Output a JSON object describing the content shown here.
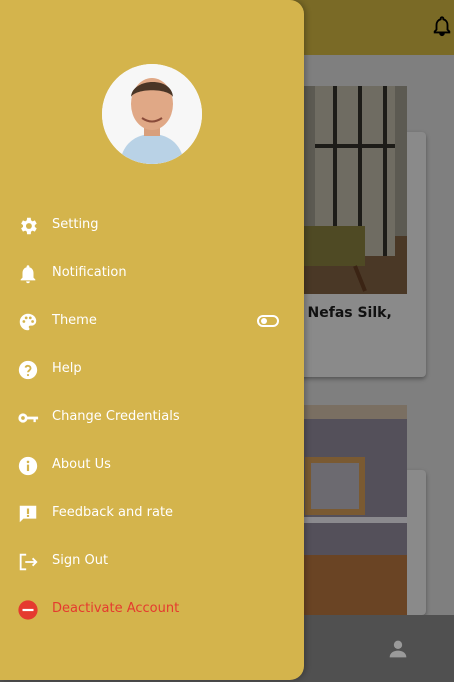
{
  "colors": {
    "drawer": "#d4b44c",
    "accent_text": "#ffffff",
    "danger": "#e53a2f"
  },
  "background": {
    "header_icon": "bell-icon",
    "card_text": "f, Nefas Silk,",
    "bottom_nav_icon": "person-icon"
  },
  "drawer": {
    "avatar": "profile-photo",
    "menu": [
      {
        "label": "Setting",
        "icon": "gear-icon"
      },
      {
        "label": "Notification",
        "icon": "bell-icon"
      },
      {
        "label": "Theme",
        "icon": "palette-icon",
        "toggle": "off"
      },
      {
        "label": "Help",
        "icon": "help-icon"
      },
      {
        "label": "Change Credentials",
        "icon": "key-icon"
      },
      {
        "label": "About Us",
        "icon": "info-icon"
      },
      {
        "label": "Feedback and rate",
        "icon": "feedback-icon"
      },
      {
        "label": "Sign Out",
        "icon": "sign-out-icon"
      },
      {
        "label": "Deactivate Account",
        "icon": "deactivate-icon"
      }
    ]
  }
}
